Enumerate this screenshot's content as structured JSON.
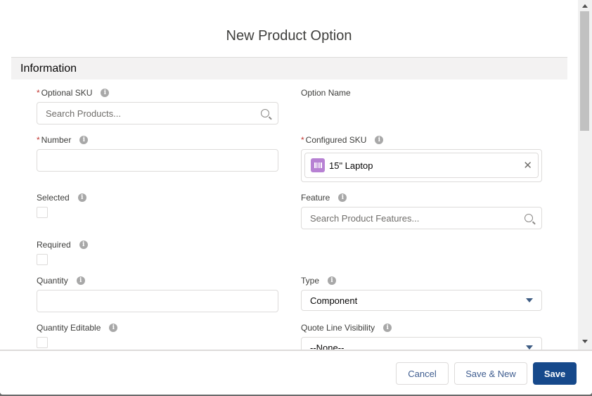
{
  "modal": {
    "title": "New Product Option",
    "section": "Information"
  },
  "fields": {
    "optional_sku": {
      "label": "Optional SKU",
      "placeholder": "Search Products..."
    },
    "option_name": {
      "label": "Option Name"
    },
    "number": {
      "label": "Number",
      "value": ""
    },
    "configured_sku": {
      "label": "Configured SKU",
      "value": "15\" Laptop",
      "icon": "product-icon",
      "color": "#b781d3"
    },
    "selected": {
      "label": "Selected",
      "checked": false
    },
    "feature": {
      "label": "Feature",
      "placeholder": "Search Product Features..."
    },
    "required": {
      "label": "Required",
      "checked": false
    },
    "quantity": {
      "label": "Quantity",
      "value": ""
    },
    "type": {
      "label": "Type",
      "value": "Component"
    },
    "quantity_editable": {
      "label": "Quantity Editable",
      "checked": false
    },
    "quote_line_visibility": {
      "label": "Quote Line Visibility",
      "value": "--None--"
    }
  },
  "footer": {
    "cancel": "Cancel",
    "save_new": "Save & New",
    "save": "Save",
    "save_color": "#16498b"
  }
}
